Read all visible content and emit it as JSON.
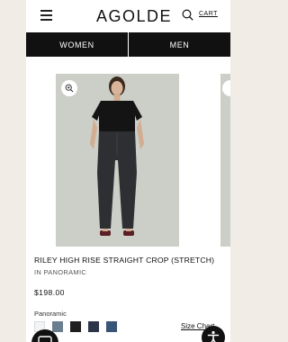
{
  "header": {
    "brand": "AGOLDE",
    "cart_label": "CART",
    "menu_icon": "hamburger-menu-icon",
    "search_icon": "search-icon"
  },
  "nav": {
    "items": [
      {
        "label": "WOMEN"
      },
      {
        "label": "MEN"
      }
    ]
  },
  "product": {
    "title": "RILEY HIGH RISE STRAIGHT CROP (STRETCH)",
    "color_name": "IN PANORAMIC",
    "price": "$198.00",
    "color_label": "Panoramic",
    "swatches": [
      {
        "color": "#f3f4f6"
      },
      {
        "color": "#6b7e8e"
      },
      {
        "color": "#1f1f22"
      },
      {
        "color": "#2c3448"
      },
      {
        "color": "#385476"
      }
    ],
    "size_chart_label": "Size Chart"
  },
  "colors": {
    "nav_bg": "#111111",
    "page_bg": "#f1ece5",
    "image_bg": "#cbcfc7"
  }
}
